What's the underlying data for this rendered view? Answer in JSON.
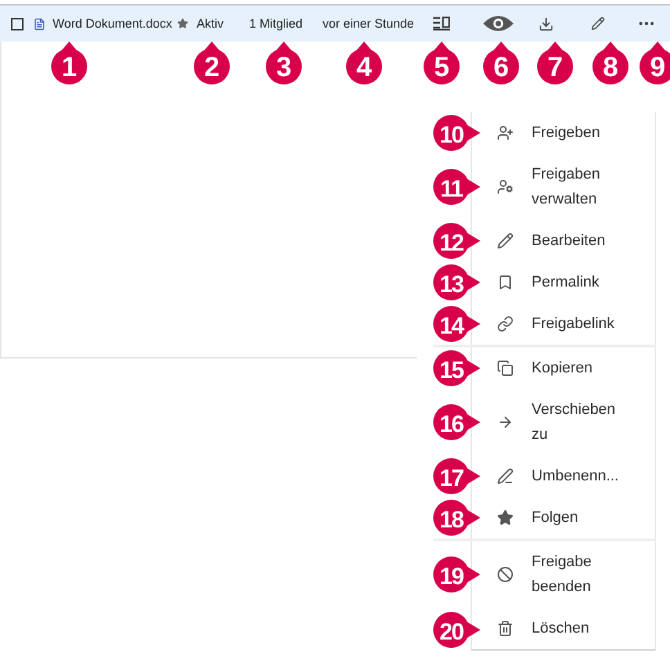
{
  "file_row": {
    "checked": false,
    "name": "Word Dokument.docx",
    "status": "Aktiv",
    "members": "1 Mitglied",
    "modified": "vor einer Stunde"
  },
  "header_callouts": [
    "1",
    "2",
    "3",
    "4",
    "5",
    "6",
    "7",
    "8",
    "9"
  ],
  "menu": [
    {
      "label": "Freigeben",
      "callout": "10"
    },
    {
      "label": "Freigaben verwalten",
      "callout": "11"
    },
    {
      "label": "Bearbeiten",
      "callout": "12"
    },
    {
      "label": "Permalink",
      "callout": "13"
    },
    {
      "label": "Freigabelink",
      "callout": "14"
    },
    {
      "label": "Kopieren",
      "callout": "15"
    },
    {
      "label": "Verschieben zu",
      "callout": "16"
    },
    {
      "label": "Umbenenn...",
      "callout": "17"
    },
    {
      "label": "Folgen",
      "callout": "18"
    },
    {
      "label": "Freigabe beenden",
      "callout": "19"
    },
    {
      "label": "Löschen",
      "callout": "20"
    }
  ]
}
